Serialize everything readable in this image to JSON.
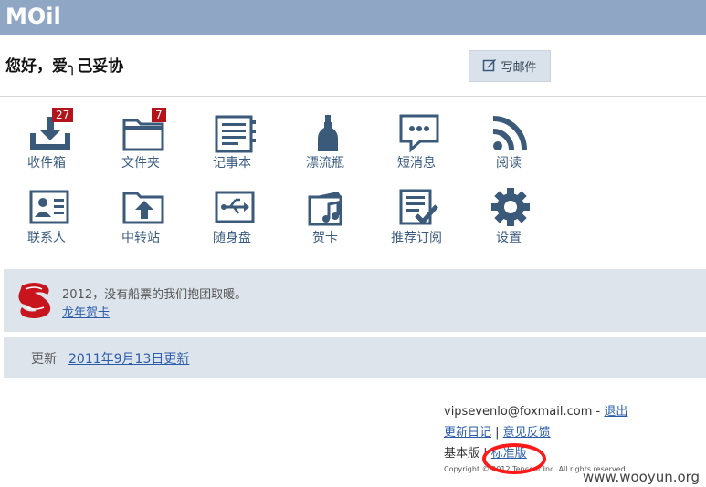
{
  "header": {
    "logo": "MOil"
  },
  "greeting": "您好，爱╮己妥协",
  "compose": {
    "label": "写邮件",
    "icon": "pencil-square-icon"
  },
  "apps": [
    {
      "id": "inbox",
      "label": "收件箱",
      "icon": "inbox-download-icon",
      "badge": "27"
    },
    {
      "id": "folders",
      "label": "文件夹",
      "icon": "folder-icon",
      "badge": "7"
    },
    {
      "id": "notepad",
      "label": "记事本",
      "icon": "notepad-icon",
      "badge": ""
    },
    {
      "id": "drift-bottle",
      "label": "漂流瓶",
      "icon": "bottle-icon",
      "badge": ""
    },
    {
      "id": "sms",
      "label": "短消息",
      "icon": "chat-bubble-icon",
      "badge": ""
    },
    {
      "id": "reader",
      "label": "阅读",
      "icon": "rss-icon",
      "badge": ""
    },
    {
      "id": "contacts",
      "label": "联系人",
      "icon": "contact-card-icon",
      "badge": ""
    },
    {
      "id": "transfer",
      "label": "中转站",
      "icon": "folder-upload-icon",
      "badge": ""
    },
    {
      "id": "usb-disk",
      "label": "随身盘",
      "icon": "usb-drive-icon",
      "badge": ""
    },
    {
      "id": "greeting-card",
      "label": "贺卡",
      "icon": "music-card-icon",
      "badge": ""
    },
    {
      "id": "subscriptions",
      "label": "推荐订阅",
      "icon": "checklist-icon",
      "badge": ""
    },
    {
      "id": "settings",
      "label": "设置",
      "icon": "gear-icon",
      "badge": ""
    }
  ],
  "promo": {
    "text": "2012，没有船票的我们抱团取暖。",
    "link": "龙年贺卡",
    "icon": "dragon-icon"
  },
  "update": {
    "label": "更新",
    "link": "2011年9月13日更新"
  },
  "footer": {
    "email": "vipsevenlo@foxmail.com",
    "sep1": " - ",
    "logout": "退出",
    "changelog": "更新日记",
    "sep2": " | ",
    "feedback": "意见反馈",
    "basic": "基本版",
    "sep3": " | ",
    "standard": "标准版",
    "copyright": "Copyright © 2012 Tencent Inc. All rights reserved."
  },
  "watermark": "www.wooyun.org",
  "colors": {
    "topbar": "#8fa7c4",
    "icon": "#3b5a7a",
    "badge": "#b3141b",
    "link": "#2a5caa",
    "banner": "#dde4ec",
    "annotation": "#ff1a1a"
  }
}
